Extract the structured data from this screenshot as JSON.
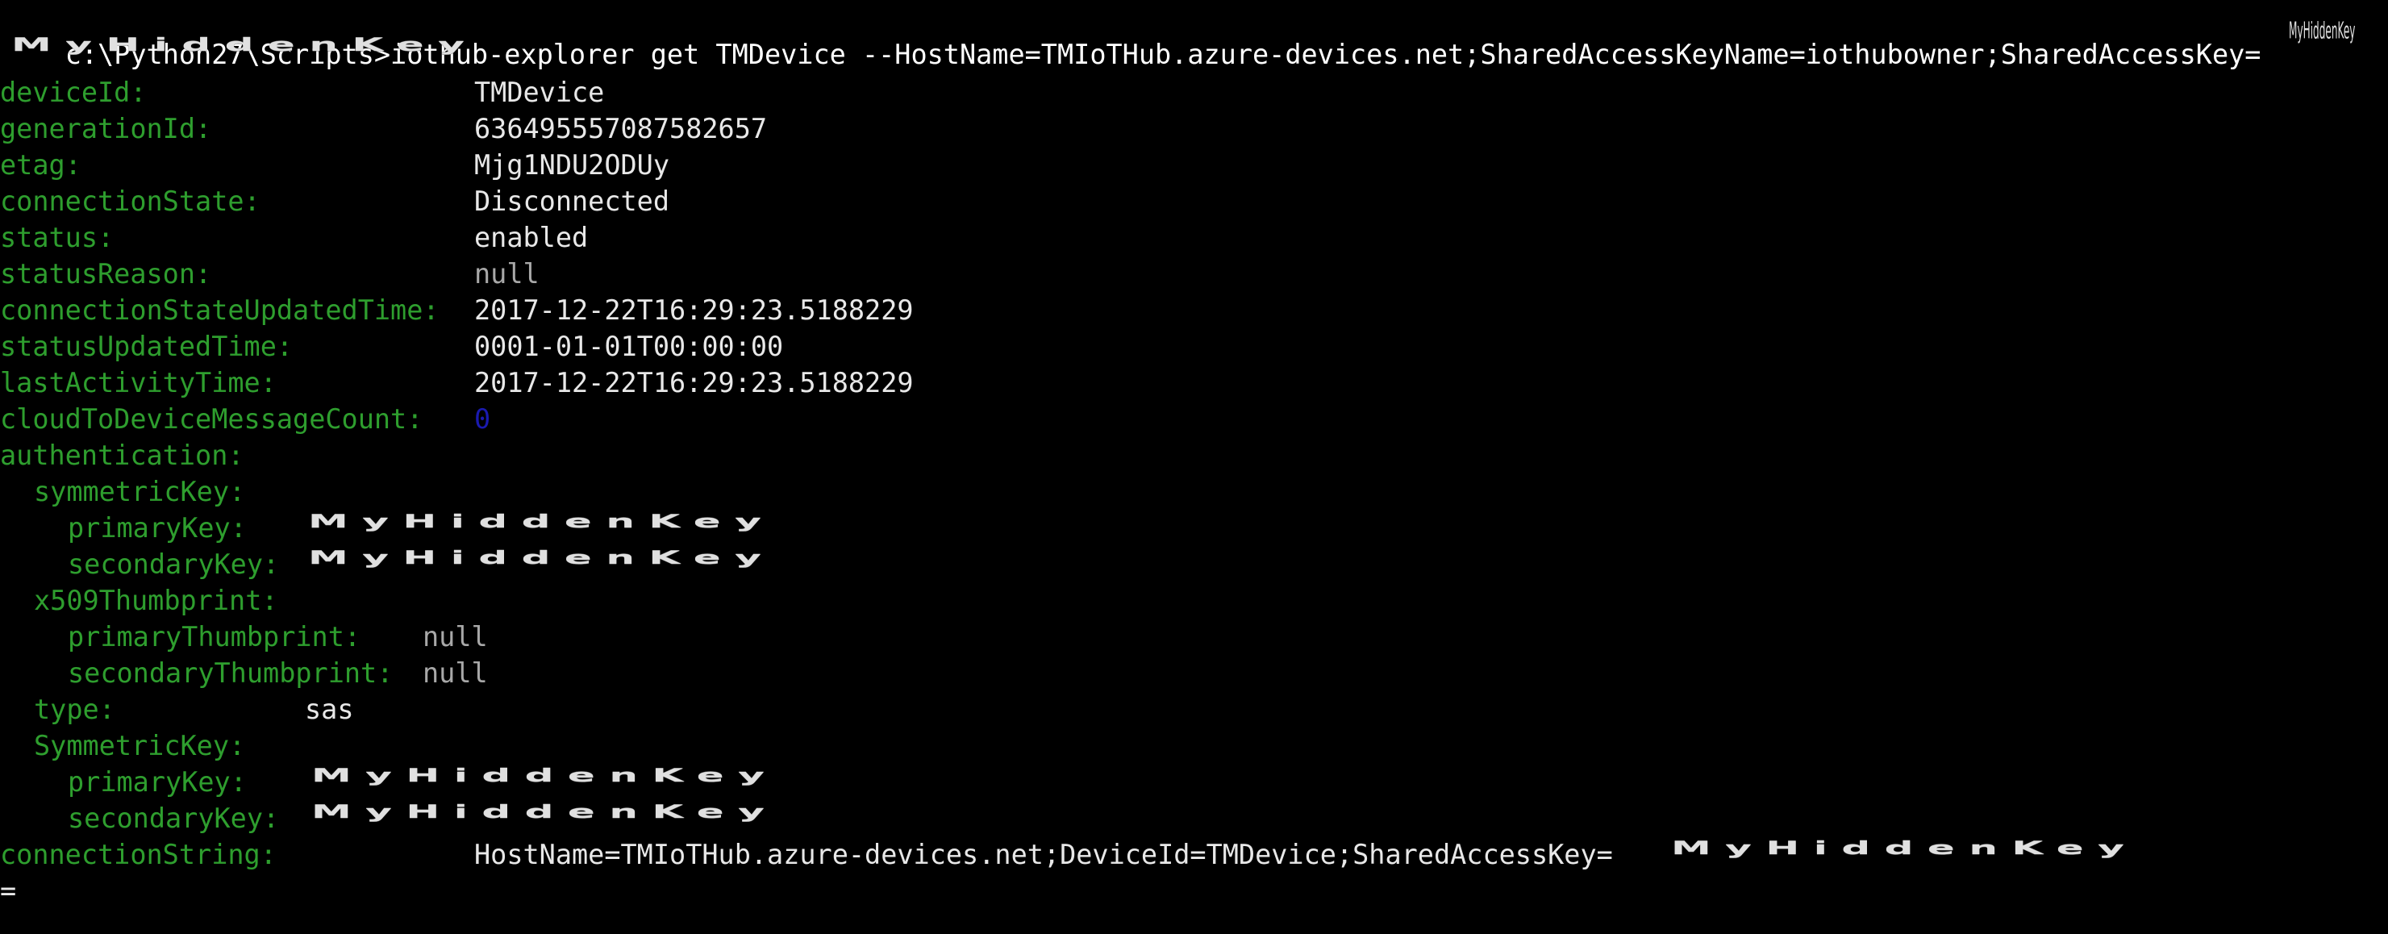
{
  "command": {
    "text": "c:\\Python27\\Scripts>iothub-explorer get TMDevice --HostName=TMIoTHub.azure-devices.net;SharedAccessKeyName=iothubowner;SharedAccessKey=",
    "hidden_key_small": "MyHiddenKey",
    "hidden_key_line2": "MyHiddenKey"
  },
  "fields": {
    "deviceId": {
      "key": "deviceId:",
      "value": "TMDevice"
    },
    "generationId": {
      "key": "generationId:",
      "value": "636495557087582657"
    },
    "etag": {
      "key": "etag:",
      "value": "Mjg1NDU2ODUy"
    },
    "connectionState": {
      "key": "connectionState:",
      "value": "Disconnected"
    },
    "status": {
      "key": "status:",
      "value": "enabled"
    },
    "statusReason": {
      "key": "statusReason:",
      "value": "null"
    },
    "connectionStateUpdatedTime": {
      "key": "connectionStateUpdatedTime:",
      "value": "2017-12-22T16:29:23.5188229"
    },
    "statusUpdatedTime": {
      "key": "statusUpdatedTime:",
      "value": "0001-01-01T00:00:00"
    },
    "lastActivityTime": {
      "key": "lastActivityTime:",
      "value": "2017-12-22T16:29:23.5188229"
    },
    "cloudToDeviceMessageCount": {
      "key": "cloudToDeviceMessageCount:",
      "value": "0"
    },
    "authentication": {
      "key": "authentication:"
    },
    "symmetricKey": {
      "key": "symmetricKey:"
    },
    "primaryKey1": {
      "key": "primaryKey:",
      "value": "MyHiddenKey"
    },
    "secondaryKey1": {
      "key": "secondaryKey:",
      "value": "MyHiddenKey"
    },
    "x509Thumbprint": {
      "key": "x509Thumbprint:"
    },
    "primaryThumbprint": {
      "key": "primaryThumbprint:",
      "value": "null"
    },
    "secondaryThumbprint": {
      "key": "secondaryThumbprint:",
      "value": "null"
    },
    "type": {
      "key": "type:",
      "value": "sas"
    },
    "SymmetricKey": {
      "key": "SymmetricKey:"
    },
    "primaryKey2": {
      "key": "primaryKey:",
      "value": "MyHiddenKey"
    },
    "secondaryKey2": {
      "key": "secondaryKey:",
      "value": "MyHiddenKey"
    },
    "connectionString": {
      "key": "connectionString:",
      "value": "HostName=TMIoTHub.azure-devices.net;DeviceId=TMDevice;SharedAccessKey=",
      "hidden_key": "MyHiddenKey"
    }
  },
  "trailing": "=",
  "colors": {
    "background": "#000000",
    "key": "#2e9e2e",
    "value": "#e8e8e8",
    "null": "#a8a8a8",
    "zero": "#1a1ab0"
  }
}
